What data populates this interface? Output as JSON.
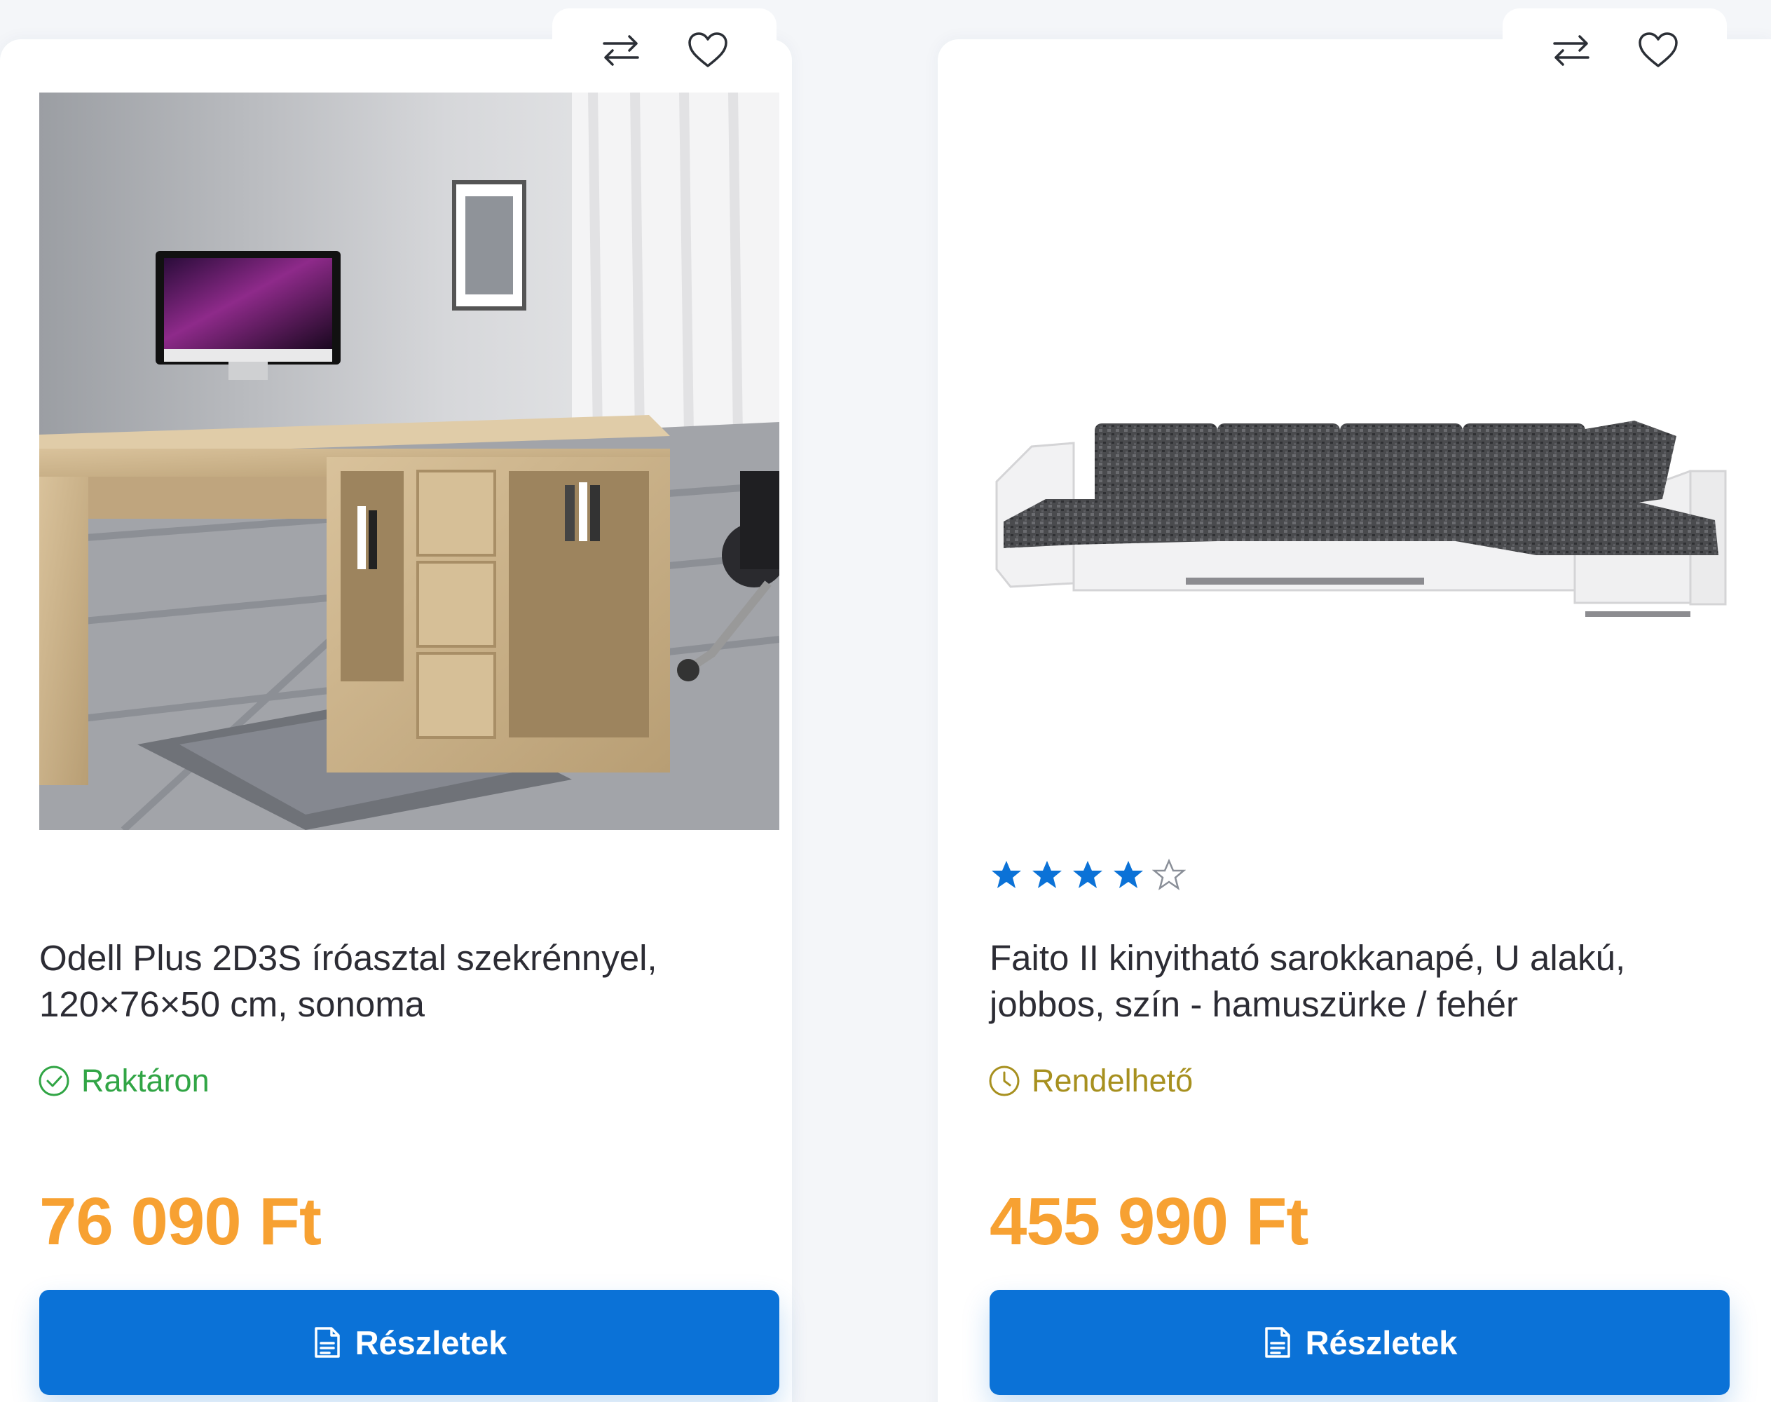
{
  "products": [
    {
      "title": "Odell Plus 2D3S íróasztal szekrénnyel, 120×76×50 cm, sonoma",
      "stock_status": "Raktáron",
      "price": "76 090 Ft",
      "button_label": "Részletek",
      "image_alt": "Odell Plus desk with cabinet",
      "stock_color": "#31a545"
    },
    {
      "title": "Faito II kinyitható sarokkanapé, U alakú, jobbos, szín - hamuszürke / fehér",
      "rating": 4,
      "rating_max": 5,
      "stock_status": "Rendelhető",
      "price": "455 990 Ft",
      "button_label": "Részletek",
      "image_alt": "Faito II U-shaped corner sofa",
      "stock_color": "#a7901f"
    }
  ],
  "colors": {
    "accent_button": "#0b72d7",
    "price": "#f7a132",
    "star_filled": "#0b72d7"
  },
  "icons": {
    "compare": "compare-arrows-icon",
    "wishlist": "heart-icon",
    "in_stock": "check-circle-icon",
    "orderable": "clock-icon",
    "details": "document-icon"
  }
}
